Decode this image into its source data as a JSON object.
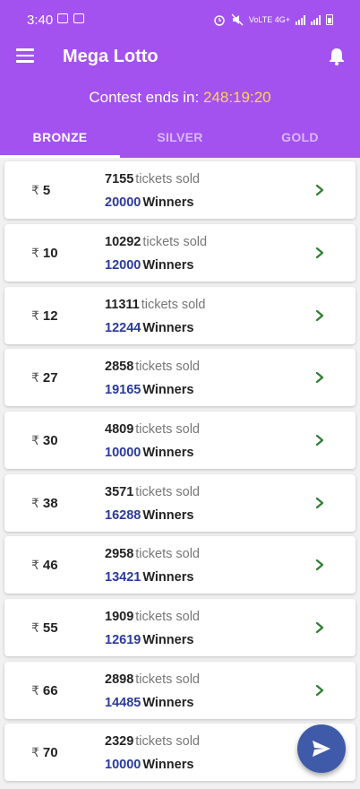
{
  "status_bar": {
    "time": "3:40",
    "network": "VoLTE 4G+"
  },
  "app_bar": {
    "title": "Mega Lotto"
  },
  "contest": {
    "label": "Contest ends in:",
    "time": "248:19:20"
  },
  "tabs": [
    {
      "label": "BRONZE",
      "active": true
    },
    {
      "label": "SILVER",
      "active": false
    },
    {
      "label": "GOLD",
      "active": false
    }
  ],
  "list": {
    "currency_symbol": "₹",
    "sold_label": "tickets sold",
    "winners_label": "Winners",
    "items": [
      {
        "price": "5",
        "sold": "7155",
        "winners": "20000"
      },
      {
        "price": "10",
        "sold": "10292",
        "winners": "12000"
      },
      {
        "price": "12",
        "sold": "11311",
        "winners": "12244"
      },
      {
        "price": "27",
        "sold": "2858",
        "winners": "19165"
      },
      {
        "price": "30",
        "sold": "4809",
        "winners": "10000"
      },
      {
        "price": "38",
        "sold": "3571",
        "winners": "16288"
      },
      {
        "price": "46",
        "sold": "2958",
        "winners": "13421"
      },
      {
        "price": "55",
        "sold": "1909",
        "winners": "12619"
      },
      {
        "price": "66",
        "sold": "2898",
        "winners": "14485"
      },
      {
        "price": "70",
        "sold": "2329",
        "winners": "10000"
      }
    ]
  },
  "colors": {
    "header": "#a352f0",
    "timer": "#ffd54f",
    "winners": "#2a3a9a",
    "chevron": "#2e7d32",
    "fab": "#3f5aa8"
  },
  "icons": {
    "menu": "hamburger-menu-icon",
    "bell": "bell-icon",
    "chevron": "chevron-right-icon",
    "fab": "send-icon"
  }
}
